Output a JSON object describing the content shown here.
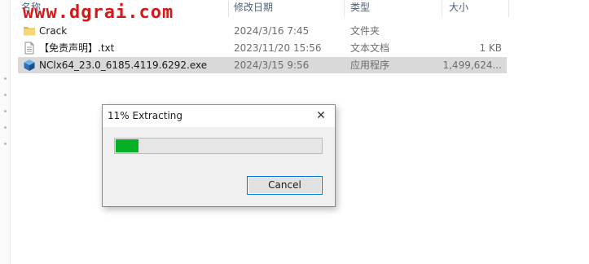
{
  "watermark": "www.dgrai.com",
  "columns": {
    "name": "名称",
    "modified": "修改日期",
    "type": "类型",
    "size": "大小"
  },
  "files": [
    {
      "name": "Crack",
      "modified": "2024/3/16 7:45",
      "type": "文件夹",
      "size": "",
      "icon": "folder-icon",
      "selected": false
    },
    {
      "name": "【免责声明】.txt",
      "modified": "2023/11/20 15:56",
      "type": "文本文档",
      "size": "1 KB",
      "icon": "text-file-icon",
      "selected": false
    },
    {
      "name": "NClx64_23.0_6185.4119.6292.exe",
      "modified": "2024/3/15 9:56",
      "type": "应用程序",
      "size": "1,499,624...",
      "icon": "installer-exe-icon",
      "selected": true
    }
  ],
  "dialog": {
    "title": "11% Extracting",
    "close_symbol": "✕",
    "progress": 0.11,
    "cancel_label": "Cancel"
  },
  "colors": {
    "progress_fill": "#06b025",
    "watermark": "#d31a1a",
    "selection": "#d9d9d9",
    "button_focus": "#0078d7"
  }
}
